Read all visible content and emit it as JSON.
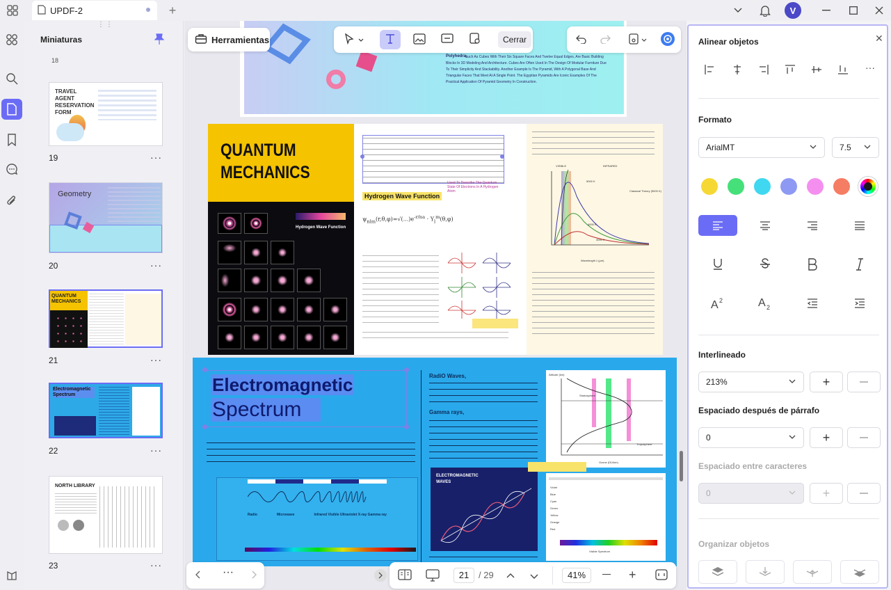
{
  "titlebar": {
    "doc_title": "UPDF-2",
    "avatar_letter": "V"
  },
  "thumbnails": {
    "title": "Miniaturas",
    "pages": [
      {
        "number": "19",
        "headline": "TRAVEL AGENT RESERVATION FORM"
      },
      {
        "number": "20",
        "headline": "Geometry"
      },
      {
        "number": "21",
        "headline": "QUANTUM MECHANICS"
      },
      {
        "number": "22",
        "headline": "Electromagnetic Spectrum"
      },
      {
        "number": "23",
        "headline": "NORTH LIBRARY"
      }
    ],
    "more": "···"
  },
  "toolbar": {
    "tools_label": "Herramientas",
    "close_label": "Cerrar"
  },
  "document": {
    "geometry_page": {
      "polyhedra_title": "Polyhedra,",
      "polyhedra_text": "Such As Cubes With Their Six Square Faces And Twelve Equal Edges, Are Basic Building Blocks In 3D Modeling And Architecture. Cubes Are Often Used In The Design Of Modular Furniture Due To Their Simplicity And Stackability. Another Example Is The Pyramid, With A Polygonal Base And Triangular Faces That Meet At A Single Point. The Egyptian Pyramids Are Iconic Examples Of The Practical Application Of Pyramid Geometry In Construction."
    },
    "quantum_page": {
      "title_line1": "QUANTUM",
      "title_line2": "MECHANICS",
      "wave_label": "Hydrogen Wave Function",
      "hwf_heading": "Hydrogen Wave Function",
      "annotation": "Used To Describe The Quantum State Of Electrons In A Hydrogen Atom",
      "chart_label_visible": "VISIBLE",
      "chart_label_infrared": "INFRARED",
      "classical": "Classical Theory (5000 K)",
      "t5000": "5000 K",
      "t4000": "4000 K",
      "t3000": "3000 K",
      "xaxis": "Wavelength λ (μm)"
    },
    "em_page": {
      "title_line1": "Electromagnetic",
      "title_line2": "Spectrum",
      "radio_heading": "RadiO Waves,",
      "gamma_heading": "Gamma rays,",
      "em_waves_label": "ELECTROMAGNETIC WAVES",
      "altitude": "Altitude (km)",
      "stratosphere": "Stratosphere",
      "troposphere": "Troposphere",
      "ozone": "Ozone (DU/km)",
      "visible_spectrum": "Visible Spectrum",
      "bands": [
        "Radio",
        "Microwave",
        "Infrared Visible Ultraviolet X-ray Gamma ray"
      ],
      "color_rows": [
        "Violet",
        "Blue",
        "Cyan",
        "Green",
        "Yellow",
        "Orange",
        "Red"
      ]
    }
  },
  "bottombar": {
    "current_page": "21",
    "total_pages": "/ 29",
    "zoom": "41%"
  },
  "right_panel": {
    "align_title": "Alinear objetos",
    "format_title": "Formato",
    "font_name": "ArialMT",
    "font_size": "7.5",
    "colors": [
      "#f5d833",
      "#45e07a",
      "#3fd8f0",
      "#8e99f3",
      "#f48ff0",
      "#f57d63"
    ],
    "line_spacing_title": "Interlineado",
    "line_spacing": "213%",
    "para_spacing_title": "Espaciado después de párrafo",
    "para_spacing": "0",
    "char_spacing_title": "Espaciado entre caracteres",
    "char_spacing": "0",
    "organize_title": "Organizar objetos"
  }
}
